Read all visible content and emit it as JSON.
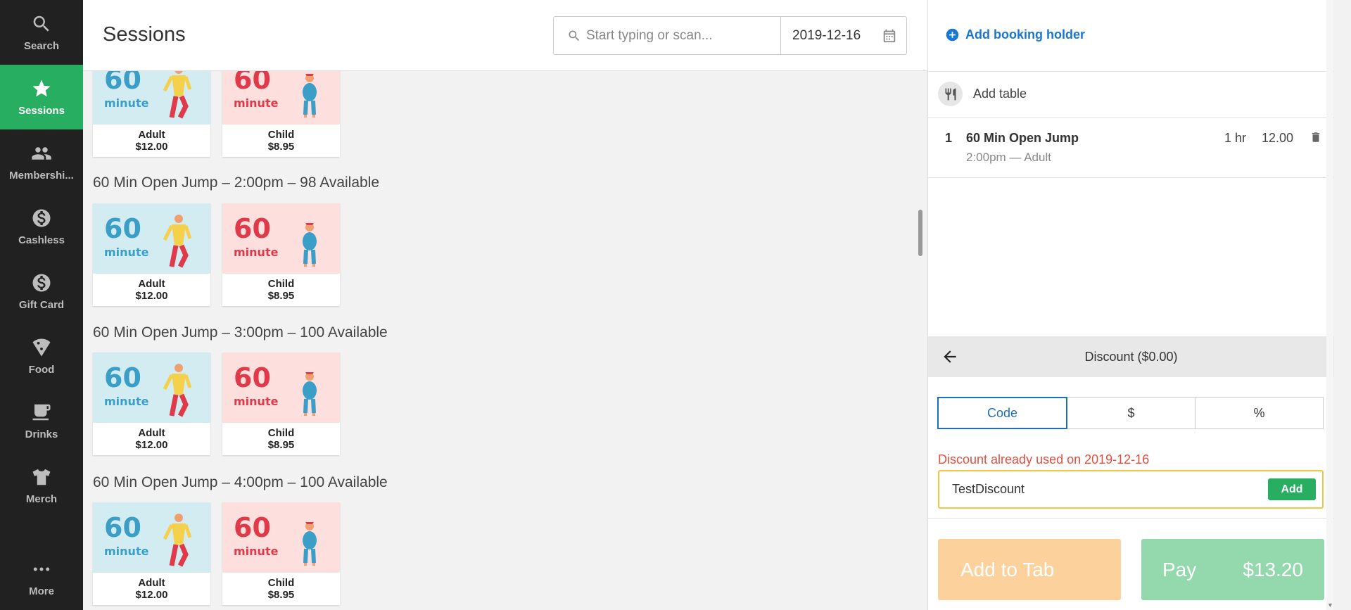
{
  "nav": {
    "items": [
      {
        "label": "Search",
        "icon": "search-icon"
      },
      {
        "label": "Sessions",
        "icon": "star-icon"
      },
      {
        "label": "Membershi...",
        "icon": "people-icon"
      },
      {
        "label": "Cashless",
        "icon": "dollar-icon"
      },
      {
        "label": "Gift Card",
        "icon": "dollar-icon"
      },
      {
        "label": "Food",
        "icon": "pizza-icon"
      },
      {
        "label": "Drinks",
        "icon": "cup-icon"
      },
      {
        "label": "Merch",
        "icon": "shirt-icon"
      },
      {
        "label": "More",
        "icon": "more-icon"
      }
    ],
    "active": "Sessions"
  },
  "header": {
    "title": "Sessions",
    "search_placeholder": "Start typing or scan...",
    "date": "2019-12-16"
  },
  "sessions": {
    "groups": [
      {
        "title": "",
        "cards": [
          {
            "label": "Adult",
            "price": "$12.00",
            "number": "60",
            "unit": "minute"
          },
          {
            "label": "Child",
            "price": "$8.95",
            "number": "60",
            "unit": "minute"
          }
        ]
      },
      {
        "title": "60 Min Open Jump – 2:00pm – 98 Available",
        "cards": [
          {
            "label": "Adult",
            "price": "$12.00",
            "number": "60",
            "unit": "minute"
          },
          {
            "label": "Child",
            "price": "$8.95",
            "number": "60",
            "unit": "minute"
          }
        ]
      },
      {
        "title": "60 Min Open Jump – 3:00pm – 100 Available",
        "cards": [
          {
            "label": "Adult",
            "price": "$12.00",
            "number": "60",
            "unit": "minute"
          },
          {
            "label": "Child",
            "price": "$8.95",
            "number": "60",
            "unit": "minute"
          }
        ]
      },
      {
        "title": "60 Min Open Jump – 4:00pm – 100 Available",
        "cards": [
          {
            "label": "Adult",
            "price": "$12.00",
            "number": "60",
            "unit": "minute"
          },
          {
            "label": "Child",
            "price": "$8.95",
            "number": "60",
            "unit": "minute"
          }
        ]
      }
    ]
  },
  "order": {
    "add_holder_label": "Add booking holder",
    "add_table_label": "Add table",
    "lines": [
      {
        "qty": "1",
        "name": "60 Min Open Jump",
        "detail": "2:00pm — Adult",
        "duration": "1 hr",
        "price": "12.00"
      }
    ]
  },
  "discount": {
    "title": "Discount ($0.00)",
    "options": [
      "Code",
      "$",
      "%"
    ],
    "selected": "Code",
    "error": "Discount already used on 2019-12-16",
    "code_value": "TestDiscount",
    "add_label": "Add"
  },
  "footer": {
    "tab_label": "Add to Tab",
    "pay_label": "Pay",
    "pay_total": "$13.20"
  },
  "colors": {
    "nav_bg": "#212121",
    "active": "#27ae60",
    "link": "#1976d2",
    "error": "#e74c3c",
    "tab_btn": "#fdd19c",
    "pay_btn": "#94d9ad"
  }
}
